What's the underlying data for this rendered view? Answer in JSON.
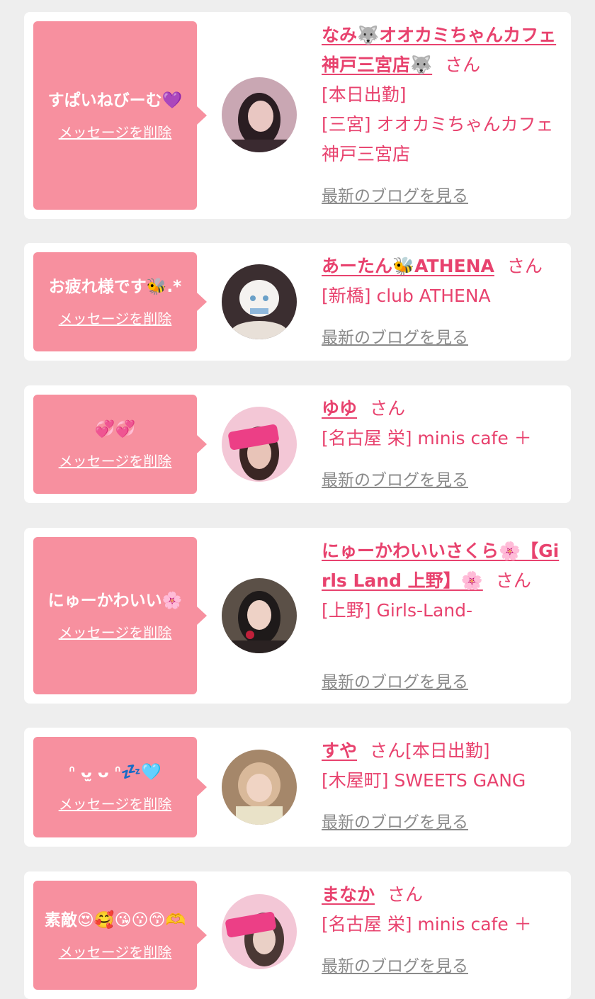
{
  "delete_label": "メッセージを削除",
  "blog_label": "最新のブログを見る",
  "san_suffix": "さん",
  "colors": {
    "accent": "#e8426e",
    "bubble": "#f7909f",
    "link_gray": "#8a8a8a",
    "background": "#eeeeee"
  },
  "cards": [
    {
      "message": "すぱいねびーむ💜",
      "name": "なみ🐺オオカミちゃんカフェ神戸三宮店🐺",
      "lines": [
        "[本日出勤]",
        "[三宮] オオカミちゃんカフェ神戸三宮店"
      ]
    },
    {
      "message": "お疲れ様です🐝.*",
      "name": "あーたん🐝ATHENA",
      "lines": [
        "[新橋] club ATHENA"
      ]
    },
    {
      "message": "💞💞",
      "name": "ゆゆ",
      "lines": [
        "[名古屋 栄] minis cafe ＋"
      ]
    },
    {
      "message": "にゅーかわいい🌸",
      "name": "にゅーかわいいさくら🌸【Girls Land 上野】🌸",
      "lines": [
        "[上野] Girls-Land-"
      ]
    },
    {
      "message": "ᐢ ᴗ̫ ᴗ ᐢ💤🩵",
      "name": "すや",
      "inline_after_san": "[本日出勤]",
      "lines": [
        "[木屋町] SWEETS GANG"
      ]
    },
    {
      "message": "素敵😍🥰😘😗😙🫶",
      "name": "まなか",
      "lines": [
        "[名古屋 栄] minis cafe ＋"
      ]
    }
  ]
}
